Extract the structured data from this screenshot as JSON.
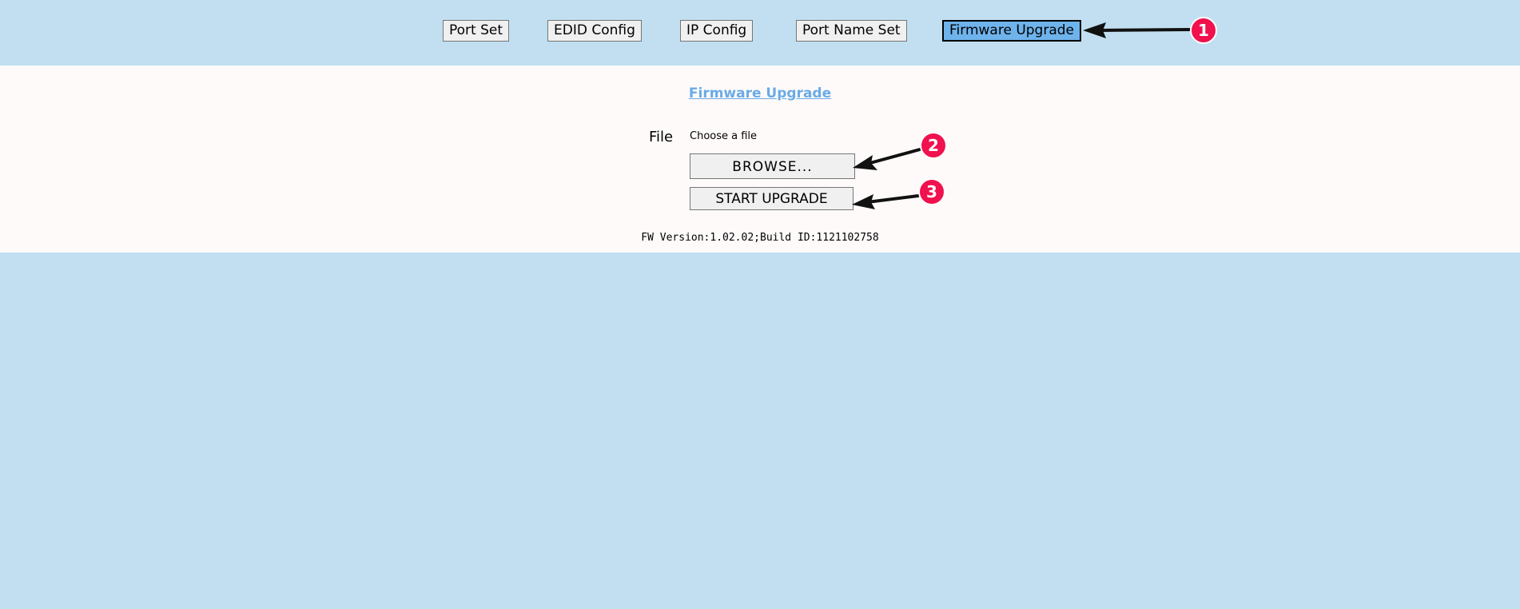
{
  "nav": {
    "port_set": "Port Set",
    "edid_config": "EDID Config",
    "ip_config": "IP Config",
    "port_name_set": "Port Name Set",
    "firmware_upgrade": "Firmware Upgrade"
  },
  "main": {
    "title": "Firmware Upgrade",
    "file_label": "File",
    "choose_label": "Choose a file",
    "browse_label": "BROWSE...",
    "start_upgrade_label": "START UPGRADE",
    "fw_version": "FW Version:1.02.02;Build ID:1121102758"
  },
  "annotations": {
    "step1": "1",
    "step2": "2",
    "step3": "3"
  },
  "colors": {
    "background": "#c1dff0",
    "panel": "#fffafa",
    "active_tab": "#6fb3ec",
    "title_link": "#6aabe6",
    "badge": "#f0114e"
  }
}
